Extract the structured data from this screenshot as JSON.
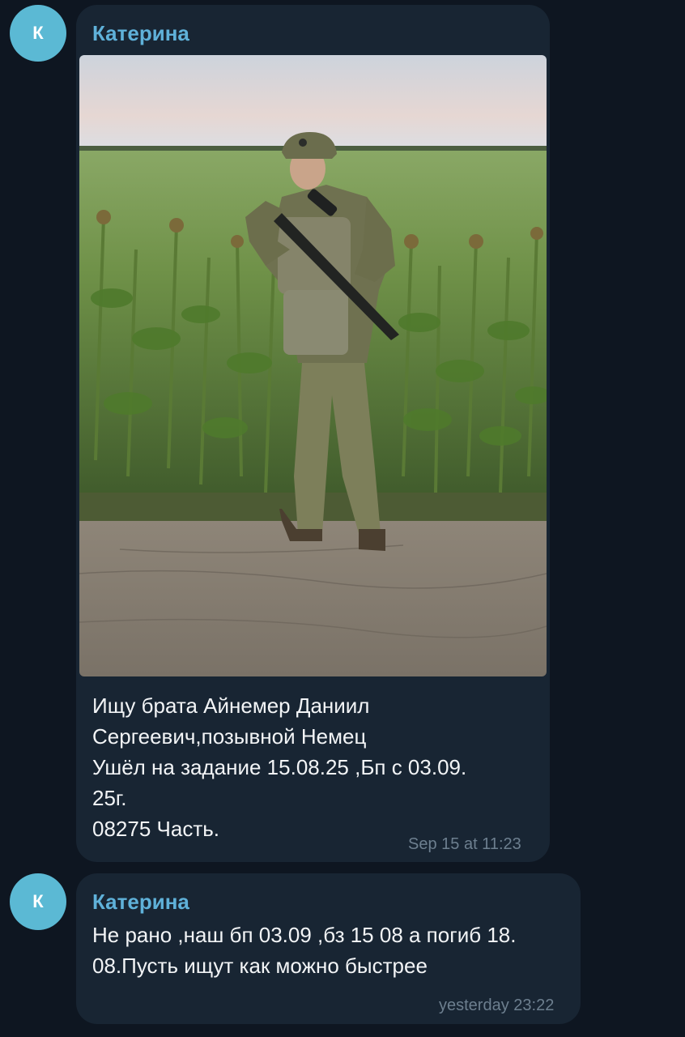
{
  "messages": [
    {
      "avatar_letter": "К",
      "sender": "Катерина",
      "text": "Ищу брата Айнемер Даниил\nСергеевич,позывной Немец\nУшёл на задание 15.08.25 ,Бп с 03.09.\n25г.\n08275 Часть.",
      "time": "Sep 15 at 11:23"
    },
    {
      "avatar_letter": "К",
      "sender": "Катерина",
      "text": "Не рано ,наш бп 03.09 ,бз 15 08 а погиб 18.\n08.Пусть ищут как можно быстрее",
      "time": "yesterday 23:22"
    }
  ]
}
